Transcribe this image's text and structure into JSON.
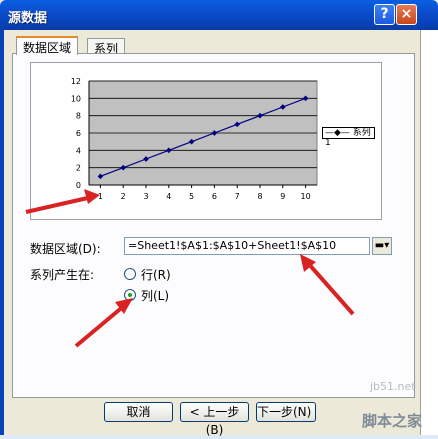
{
  "dialog": {
    "title": "源数据",
    "help_icon": "?",
    "close_icon": "×"
  },
  "tabs": [
    {
      "label": "数据区域"
    },
    {
      "label": "系列"
    }
  ],
  "chart_data": {
    "type": "line",
    "x": [
      1,
      2,
      3,
      4,
      5,
      6,
      7,
      8,
      9,
      10
    ],
    "series": [
      {
        "name": "系列1",
        "values": [
          1,
          2,
          3,
          4,
          5,
          6,
          7,
          8,
          9,
          10
        ]
      }
    ],
    "xticks": [
      "1",
      "2",
      "3",
      "4",
      "5",
      "6",
      "7",
      "8",
      "9",
      "10"
    ],
    "yticks": [
      "0",
      "2",
      "4",
      "6",
      "8",
      "10",
      "12"
    ],
    "ylim": [
      0,
      12
    ],
    "grid": true,
    "plot_background": "#c0c0c0",
    "series_color": "#000080",
    "legend_position": "right"
  },
  "form": {
    "range_label": "数据区域(D):",
    "range_value": "=Sheet1!$A$1:$A$10+Sheet1!$A$10",
    "collapse_icon": "range-picker-icon",
    "series_in_label": "系列产生在:",
    "row_label": "行(R)",
    "column_label": "列(L)",
    "selected": "column"
  },
  "buttons": {
    "cancel": "取消",
    "back": "< 上一步(B)",
    "next": "下一步(N) >"
  },
  "watermarks": {
    "site": "jb51.net",
    "brand": "脚本之家"
  },
  "annotation_color": "#d92222"
}
